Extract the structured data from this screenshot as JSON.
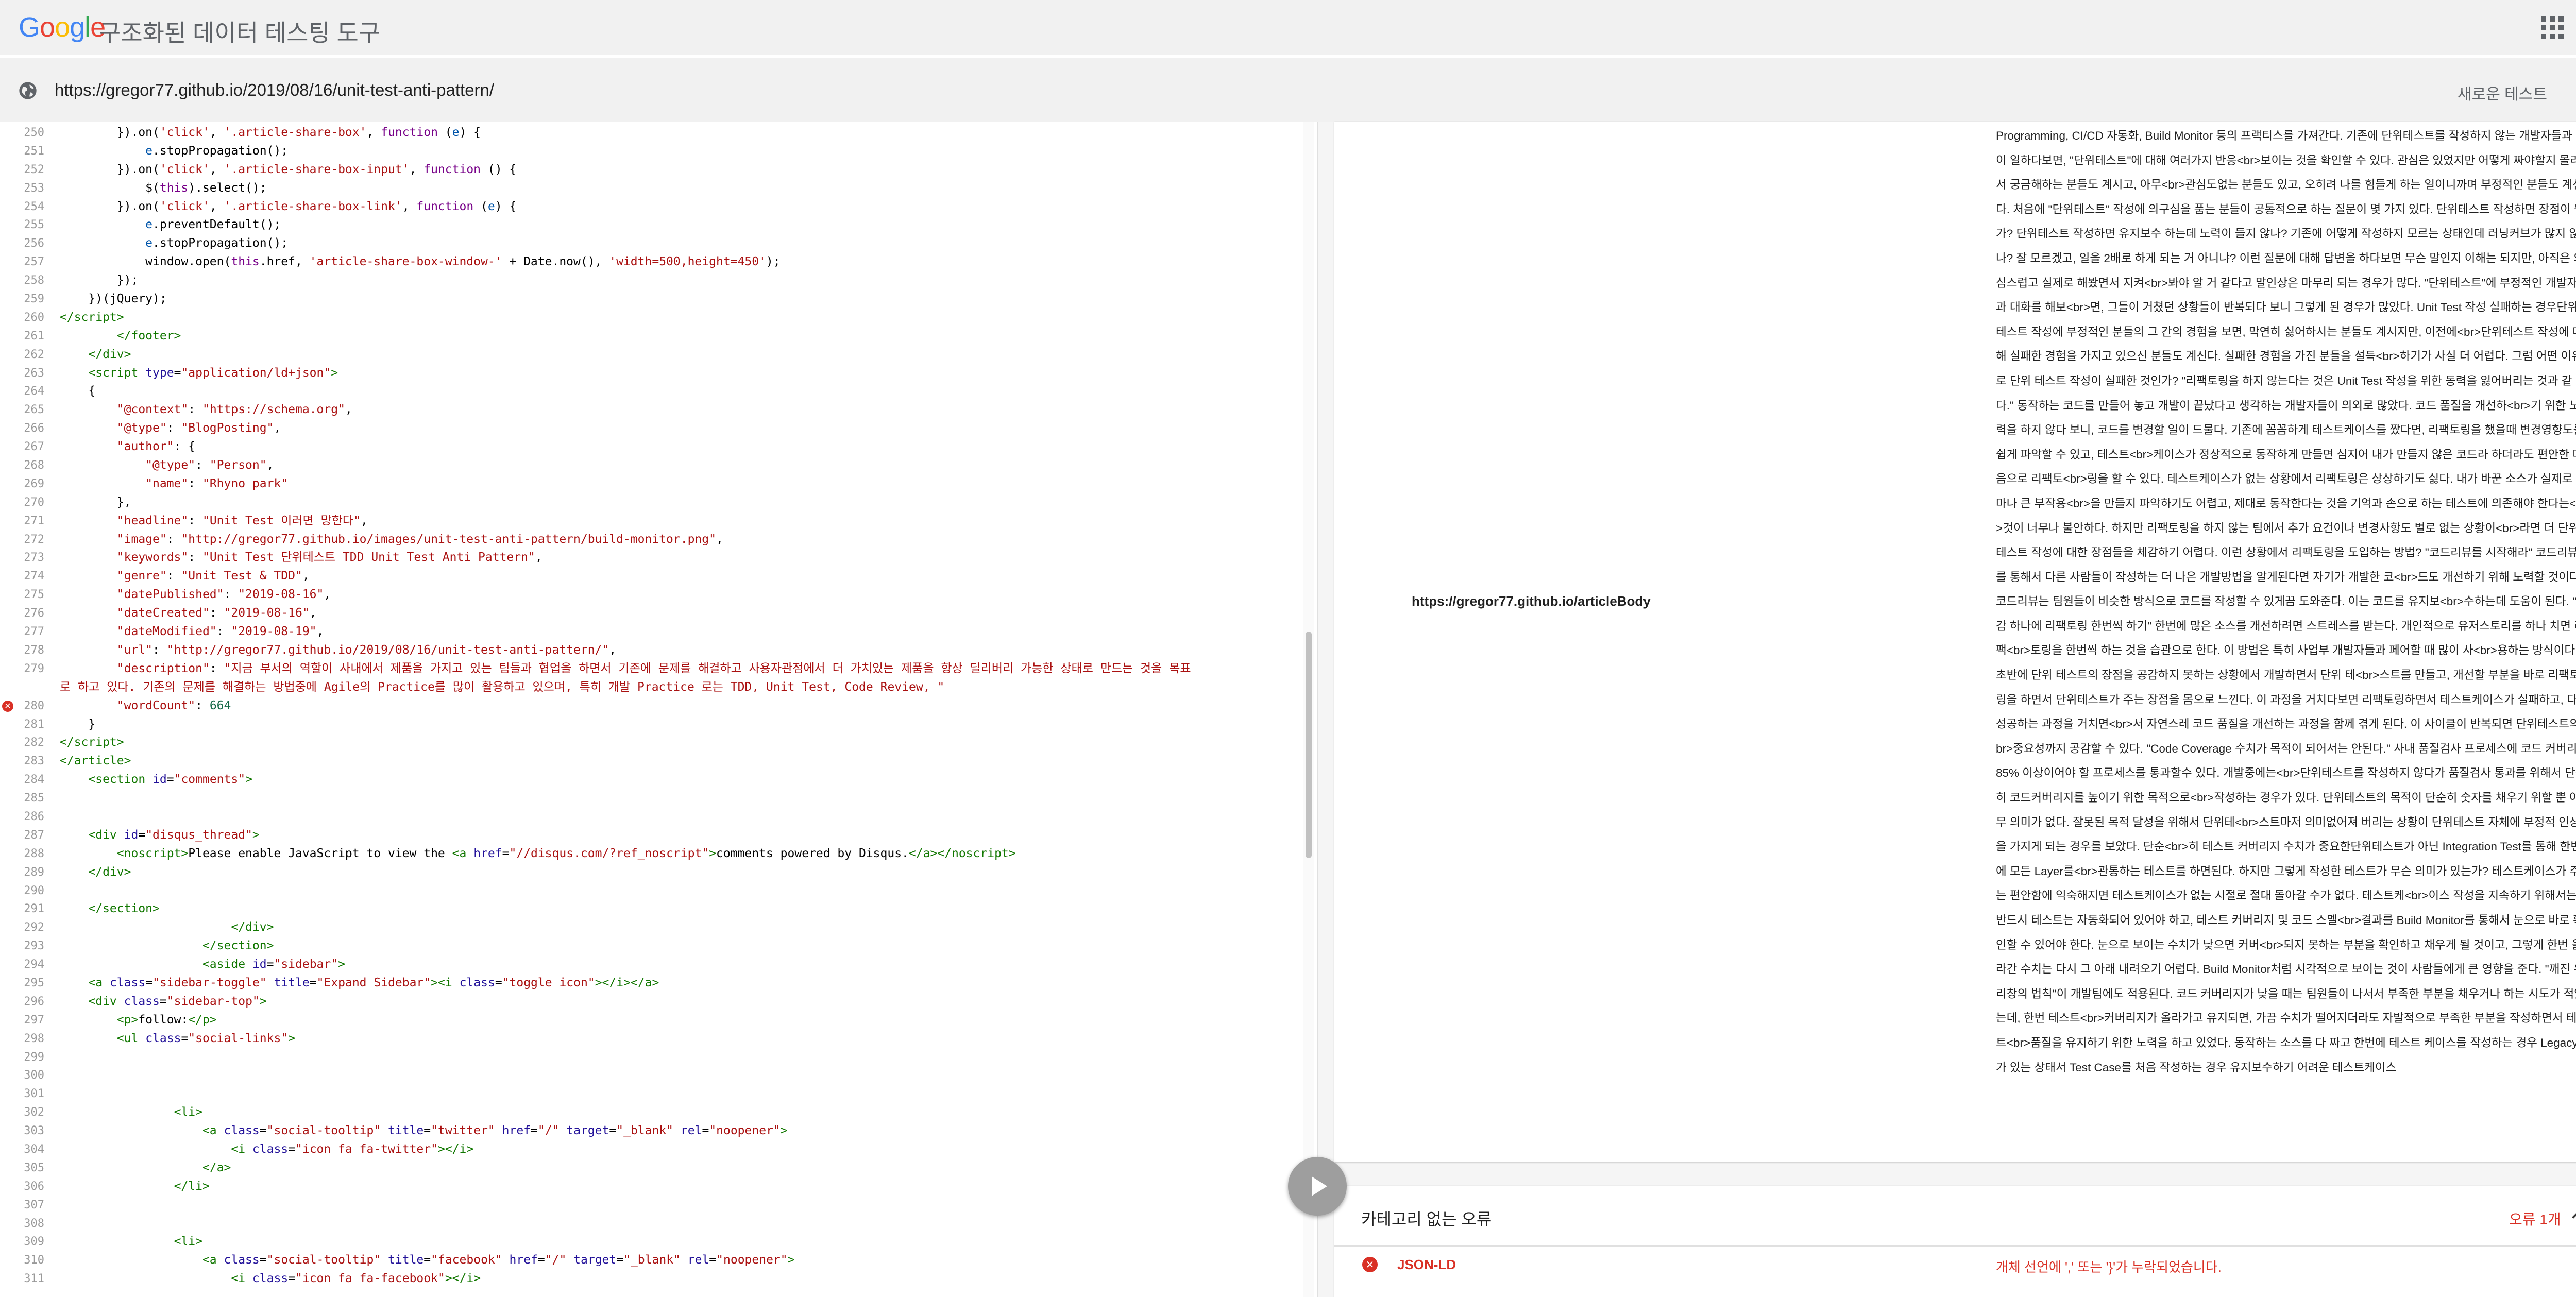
{
  "header": {
    "logo": [
      "G",
      "o",
      "o",
      "g",
      "l",
      "e"
    ],
    "title": "구조화된 데이터 테스팅 도구"
  },
  "urlbar": {
    "url": "https://gregor77.github.io/2019/08/16/unit-test-anti-pattern/",
    "new_test_label": "새로운 테스트"
  },
  "icons": {
    "globe": "globe-icon",
    "settings": "gear-icon",
    "apps": "apps-grid-icon",
    "run": "play-icon",
    "collapse": "chevron-up-icon",
    "error": "error-x-icon"
  },
  "colors": {
    "error": "#d93025",
    "keyword": "#770088",
    "string": "#aa1111",
    "variable": "#0055aa",
    "tag": "#117700",
    "attribute": "#221199"
  },
  "code": {
    "error_line": 280,
    "lines": [
      {
        "n": "250",
        "h": "        }).on(<span class=\"s\">'click'</span>, <span class=\"s\">'.article-share-box'</span>, <span class=\"k\">function</span> (<span class=\"v\">e</span>) {"
      },
      {
        "n": "251",
        "h": "            <span class=\"v\">e</span>.stopPropagation();"
      },
      {
        "n": "252",
        "h": "        }).on(<span class=\"s\">'click'</span>, <span class=\"s\">'.article-share-box-input'</span>, <span class=\"k\">function</span> () {"
      },
      {
        "n": "253",
        "h": "            $(<span class=\"k\">this</span>).select();"
      },
      {
        "n": "254",
        "h": "        }).on(<span class=\"s\">'click'</span>, <span class=\"s\">'.article-share-box-link'</span>, <span class=\"k\">function</span> (<span class=\"v\">e</span>) {"
      },
      {
        "n": "255",
        "h": "            <span class=\"v\">e</span>.preventDefault();"
      },
      {
        "n": "256",
        "h": "            <span class=\"v\">e</span>.stopPropagation();"
      },
      {
        "n": "257",
        "h": "            window.open(<span class=\"k\">this</span>.href, <span class=\"s\">'article-share-box-window-'</span> + Date.now(), <span class=\"s\">'width=500,height=450'</span>);"
      },
      {
        "n": "258",
        "h": "        });"
      },
      {
        "n": "259",
        "h": "    })(jQuery);"
      },
      {
        "n": "260",
        "h": "<span class=\"t\">&lt;/script&gt;</span>"
      },
      {
        "n": "261",
        "h": "        <span class=\"t\">&lt;/footer&gt;</span>"
      },
      {
        "n": "262",
        "h": "    <span class=\"t\">&lt;/div&gt;</span>"
      },
      {
        "n": "263",
        "h": "    <span class=\"t\">&lt;script</span> <span class=\"a\">type</span>=<span class=\"s\">\"application/ld+json\"</span><span class=\"t\">&gt;</span>"
      },
      {
        "n": "264",
        "h": "    {"
      },
      {
        "n": "265",
        "h": "        <span class=\"s\">\"@context\"</span>: <span class=\"s\">\"https://schema.org\"</span>,"
      },
      {
        "n": "266",
        "h": "        <span class=\"s\">\"@type\"</span>: <span class=\"s\">\"BlogPosting\"</span>,"
      },
      {
        "n": "267",
        "h": "        <span class=\"s\">\"author\"</span>: {"
      },
      {
        "n": "268",
        "h": "            <span class=\"s\">\"@type\"</span>: <span class=\"s\">\"Person\"</span>,"
      },
      {
        "n": "269",
        "h": "            <span class=\"s\">\"name\"</span>: <span class=\"s\">\"Rhyno park\"</span>"
      },
      {
        "n": "270",
        "h": "        },"
      },
      {
        "n": "271",
        "h": "        <span class=\"s\">\"headline\"</span>: <span class=\"s\">\"Unit Test 이러면 망한다\"</span>,"
      },
      {
        "n": "272",
        "h": "        <span class=\"s\">\"image\"</span>: <span class=\"s\">\"http://gregor77.github.io/images/unit-test-anti-pattern/build-monitor.png\"</span>,"
      },
      {
        "n": "273",
        "h": "        <span class=\"s\">\"keywords\"</span>: <span class=\"s\">\"Unit Test 단위테스트 TDD Unit Test Anti Pattern\"</span>,"
      },
      {
        "n": "274",
        "h": "        <span class=\"s\">\"genre\"</span>: <span class=\"s\">\"Unit Test &amp; TDD\"</span>,"
      },
      {
        "n": "275",
        "h": "        <span class=\"s\">\"datePublished\"</span>: <span class=\"s\">\"2019-08-16\"</span>,"
      },
      {
        "n": "276",
        "h": "        <span class=\"s\">\"dateCreated\"</span>: <span class=\"s\">\"2019-08-16\"</span>,"
      },
      {
        "n": "277",
        "h": "        <span class=\"s\">\"dateModified\"</span>: <span class=\"s\">\"2019-08-19\"</span>,"
      },
      {
        "n": "278",
        "h": "        <span class=\"s\">\"url\"</span>: <span class=\"s\">\"http://gregor77.github.io/2019/08/16/unit-test-anti-pattern/\"</span>,"
      },
      {
        "n": "279",
        "h": "        <span class=\"s\">\"description\"</span>: <span class=\"s\">\"지금 부서의 역할이 사내에서 제품을 가지고 있는 팀들과 협업을 하면서 기존에 문제를 해결하고 사용자관점에서 더 가치있는 제품을 항상 딜리버리 가능한 상태로 만드는 것을 목표</span>"
      },
      {
        "n": "",
        "h": "<span class=\"s\">로 하고 있다. 기존의 문제를 해결하는 방법중에 Agile의 Practice를 많이 활용하고 있으며, 특히 개발 Practice 로는 TDD, Unit Test, Code Review, \"</span>"
      },
      {
        "n": "280",
        "h": "        <span class=\"s\">\"wordCount\"</span>: <span class=\"n\">664</span>"
      },
      {
        "n": "281",
        "h": "    }"
      },
      {
        "n": "282",
        "h": "<span class=\"t\">&lt;/script&gt;</span>"
      },
      {
        "n": "283",
        "h": "<span class=\"t\">&lt;/article&gt;</span>"
      },
      {
        "n": "284",
        "h": "    <span class=\"t\">&lt;section</span> <span class=\"a\">id</span>=<span class=\"s\">\"comments\"</span><span class=\"t\">&gt;</span>"
      },
      {
        "n": "285",
        "h": ""
      },
      {
        "n": "286",
        "h": ""
      },
      {
        "n": "287",
        "h": "    <span class=\"t\">&lt;div</span> <span class=\"a\">id</span>=<span class=\"s\">\"disqus_thread\"</span><span class=\"t\">&gt;</span>"
      },
      {
        "n": "288",
        "h": "        <span class=\"t\">&lt;noscript&gt;</span>Please enable JavaScript to view the <span class=\"t\">&lt;a</span> <span class=\"a\">href</span>=<span class=\"s\">\"//disqus.com/?ref_noscript\"</span><span class=\"t\">&gt;</span>comments powered by Disqus.<span class=\"t\">&lt;/a&gt;&lt;/noscript&gt;</span>"
      },
      {
        "n": "289",
        "h": "    <span class=\"t\">&lt;/div&gt;</span>"
      },
      {
        "n": "290",
        "h": ""
      },
      {
        "n": "291",
        "h": "    <span class=\"t\">&lt;/section&gt;</span>"
      },
      {
        "n": "292",
        "h": "                        <span class=\"t\">&lt;/div&gt;</span>"
      },
      {
        "n": "293",
        "h": "                    <span class=\"t\">&lt;/section&gt;</span>"
      },
      {
        "n": "294",
        "h": "                    <span class=\"t\">&lt;aside</span> <span class=\"a\">id</span>=<span class=\"s\">\"sidebar\"</span><span class=\"t\">&gt;</span>"
      },
      {
        "n": "295",
        "h": "    <span class=\"t\">&lt;a</span> <span class=\"a\">class</span>=<span class=\"s\">\"sidebar-toggle\"</span> <span class=\"a\">title</span>=<span class=\"s\">\"Expand Sidebar\"</span><span class=\"t\">&gt;&lt;i</span> <span class=\"a\">class</span>=<span class=\"s\">\"toggle icon\"</span><span class=\"t\">&gt;&lt;/i&gt;&lt;/a&gt;</span>"
      },
      {
        "n": "296",
        "h": "    <span class=\"t\">&lt;div</span> <span class=\"a\">class</span>=<span class=\"s\">\"sidebar-top\"</span><span class=\"t\">&gt;</span>"
      },
      {
        "n": "297",
        "h": "        <span class=\"t\">&lt;p&gt;</span>follow:<span class=\"t\">&lt;/p&gt;</span>"
      },
      {
        "n": "298",
        "h": "        <span class=\"t\">&lt;ul</span> <span class=\"a\">class</span>=<span class=\"s\">\"social-links\"</span><span class=\"t\">&gt;</span>"
      },
      {
        "n": "299",
        "h": ""
      },
      {
        "n": "300",
        "h": ""
      },
      {
        "n": "301",
        "h": ""
      },
      {
        "n": "302",
        "h": "                <span class=\"t\">&lt;li&gt;</span>"
      },
      {
        "n": "303",
        "h": "                    <span class=\"t\">&lt;a</span> <span class=\"a\">class</span>=<span class=\"s\">\"social-tooltip\"</span> <span class=\"a\">title</span>=<span class=\"s\">\"twitter\"</span> <span class=\"a\">href</span>=<span class=\"s\">\"/\"</span> <span class=\"a\">target</span>=<span class=\"s\">\"_blank\"</span> <span class=\"a\">rel</span>=<span class=\"s\">\"noopener\"</span><span class=\"t\">&gt;</span>"
      },
      {
        "n": "304",
        "h": "                        <span class=\"t\">&lt;i</span> <span class=\"a\">class</span>=<span class=\"s\">\"icon fa fa-twitter\"</span><span class=\"t\">&gt;&lt;/i&gt;</span>"
      },
      {
        "n": "305",
        "h": "                    <span class=\"t\">&lt;/a&gt;</span>"
      },
      {
        "n": "306",
        "h": "                <span class=\"t\">&lt;/li&gt;</span>"
      },
      {
        "n": "307",
        "h": ""
      },
      {
        "n": "308",
        "h": ""
      },
      {
        "n": "309",
        "h": "                <span class=\"t\">&lt;li&gt;</span>"
      },
      {
        "n": "310",
        "h": "                    <span class=\"t\">&lt;a</span> <span class=\"a\">class</span>=<span class=\"s\">\"social-tooltip\"</span> <span class=\"a\">title</span>=<span class=\"s\">\"facebook\"</span> <span class=\"a\">href</span>=<span class=\"s\">\"/\"</span> <span class=\"a\">target</span>=<span class=\"s\">\"_blank\"</span> <span class=\"a\">rel</span>=<span class=\"s\">\"noopener\"</span><span class=\"t\">&gt;</span>"
      },
      {
        "n": "311",
        "h": "                        <span class=\"t\">&lt;i</span> <span class=\"a\">class</span>=<span class=\"s\">\"icon fa fa-facebook\"</span><span class=\"t\">&gt;&lt;/i&gt;</span>"
      }
    ]
  },
  "result": {
    "property_name": "https://gregor77.github.io/articleBody",
    "property_value": "Programming, CI/CD 자동화, Build Monitor 등의 프랙티스를 가져간다. 기존에 단위테스트를 작성하지 않는 개발자들과 같이 일하다보면, \"단위테스트\"에 대해 여러가지 반응<br>보이는 것을 확인할 수 있다. 관심은 있었지만 어떻게 짜야할지 몰라서 궁금해하는 분들도 계시고, 아무<br>관심도없는 분들도 있고, 오히려 나를 힘들게 하는 일이니까며 부정적인 분들도 계신다. 처음에 \"단위테스트\" 작성에 의구심을 품는 분들이 공통적으로 하는 질문이 몇 가지 있다. 단위테스트 작성하면 장점이 뭔가? 단위테스트 작성하면 유지보수 하는데 노력이 들지 않나? 기존에 어떻게 작성하지 모르는 상태인데 러닝커브가 많지 않나? 잘 모르겠고, 일을 2배로 하게 되는 거 아니냐? 이런 질문에 대해 답변을 하다보면 무슨 말인지 이해는 되지만, 아직은 의심스럽고 실제로 해봤면서 지켜<br>봐야 알 거 같다고 말인상은 마무리 되는 경우가 많다. \"단위테스트\"에 부정적인 개발자들과 대화를 해보<br>면, 그들이 거쳤던 상황들이 반복되다 보니 그렇게 된 경우가 많았다. Unit Test 작성 실패하는 경우단위 테스트 작성에 부정적인 분들의 그 간의 경험을 보면, 막연히 싫어하시는 분들도 계시지만, 이전에<br>단위테스트 작성에 대해 실패한 경험을 가지고 있으신 분들도 계신다. 실패한 경험을 가진 분들을 설득<br>하기가 사실 더 어렵다. 그럼 어떤 이유로 단위 테스트 작성이 실패한 것인가? \"리팩토링을 하지 않는다는 것은 Unit Test 작성을 위한 동력을 잃어버리는 것과 같다.\" 동작하는 코드를 만들어 놓고 개발이 끝났다고 생각하는 개발자들이 의외로 많았다. 코드 품질을 개선하<br>기 위한 노력을 하지 않다 보니, 코드를 변경할 일이 드물다. 기존에 꼼꼼하게 테스트케이스를 짰다면, 리팩토링을 했을때 변경영향도를 쉽게 파악할 수 있고, 테스트<br>케이스가 정상적으로 동작하게 만들면 심지어 내가 만들지 않은 코드라 하더라도 편안한 마음으로 리팩토<br>링을 할 수 있다. 테스트케이스가 없는 상황에서 리팩토링은 상상하기도 싫다. 내가 바꾼 소스가 실제로 얼마나 큰 부작용<br>을 만들지 파악하기도 어렵고, 제대로 동작한다는 것을 기억과 손으로 하는 테스트에 의존해야 한다는<br>것이 너무나 불안하다. 하지만 리팩토링을 하지 않는 팀에서 추가 요건이나 변경사항도 별로 없는 상황이<br>라면 더 단위테스트 작성에 대한 장점들을 체감하기 어렵다. 이런 상황에서 리팩토링을 도입하는 방법? \"코드리뷰를 시작해라\" 코드리뷰를 통해서 다른 사람들이 작성하는 더 나은 개발방법을 알게된다면 자기가 개발한 코<br>드도 개선하기 위해 노력할 것이다. 코드리뷰는 팀원들이 비슷한 방식으로 코드를 작성할 수 있게끔 도와준다. 이는 코드를 유지보<br>수하는데 도움이 된다. \"일감 하나에 리팩토링 한번씩 하기\" 한번에 많은 소스를 개선하려면 스트레스를 받는다. 개인적으로 유저스토리를 하나 치면 리팩<br>토링을 한번씩 하는 것을 습관으로 한다. 이 방법은 특히 사업부 개발자들과 페어할 때 많이 사<br>용하는 방식이다. 초반에 단위 테스트의 장점을 공감하지 못하는 상황에서 개발하면서 단위 테<br>스트를 만들고, 개선할 부분을 바로 리팩토링을 하면서 단위테스트가 주는 장점을 몸으로 느낀다. 이 과정을 거치다보면 리팩토링하면서 테스트케이스가 실패하고, 다시 성공하는 과정을 거치면<br>서 자연스레 코드 품질을 개선하는 과정을 함께 겪게 된다. 이 사이클이 반복되면 단위테스트의<br>중요성까지 공감할 수 있다. \"Code Coverage 수치가 목적이 되어서는 안된다.\" 사내 품질검사 프로세스에 코드 커버리지 85% 이상이어야 할 프로세스를 통과할수 있다. 개발중에는<br>단위테스트를 작성하지 않다가 품질검사 통과를 위해서 단순히 코드커버리지를 높이기 위한 목적으로<br>작성하는 경우가 있다. 단위테스트의 목적이 단순히 숫자를 채우기 위할 뿐 아무 의미가 없다. 잘못된 목적 달성을 위해서 단위테<br>스트마저 의미없어져 버리는 상황이 단위테스트 자체에 부정적 인상을 가지게 되는 경우를 보았다. 단순<br>히 테스트 커버리지 수치가 중요한단위테스트가 아닌 Integration Test를 통해 한번에 모든 Layer를<br>관통하는 테스트를 하면된다. 하지만 그렇게 작성한 테스트가 무슨 의미가 있는가? 테스트케이스가 주는 편안함에 익숙해지면 테스트케이스가 없는 시절로 절대 돌아갈 수가 없다. 테스트케<br>이스 작성을 지속하기 위해서는 반드시 테스트는 자동화되어 있어야 하고, 테스트 커버리지 및 코드 스멜<br>결과를 Build Monitor를 통해서 눈으로 바로 확인할 수 있어야 한다. 눈으로 보이는 수치가 낮으면 커버<br>되지 못하는 부분을 확인하고 채우게 될 것이고, 그렇게 한번 올라간 수치는 다시 그 아래 내려오기 어렵다. Build Monitor처럼 시각적으로 보이는 것이 사람들에게 큰 영향을 준다. \"깨진 유리창의 법칙\"이 개발팀에도 적용된다. 코드 커버리지가 낮을 때는 팀원들이 나서서 부족한 부분을 채우거나 하는 시도가 적었는데, 한번 테스트<br>커버리지가 올라가고 유지되면, 가끔 수치가 떨어지더라도 자발적으로 부족한 부분을 작성하면서 테스트<br>품질을 유지하기 위한 노력을 하고 있었다. 동작하는 소스를 다 짜고 한번에 테스트 케이스를 작성하는 경우 Legacy가 있는 상태서 Test Case를 처음 작성하는 경우 유지보수하기 어려운 테스트케이스"
  },
  "errors": {
    "category_label": "카테고리 없는 오류",
    "count_label": "오류 1개",
    "items": [
      {
        "type": "JSON-LD",
        "message": "개체 선언에 ',' 또는 '}'가 누락되었습니다."
      }
    ]
  }
}
